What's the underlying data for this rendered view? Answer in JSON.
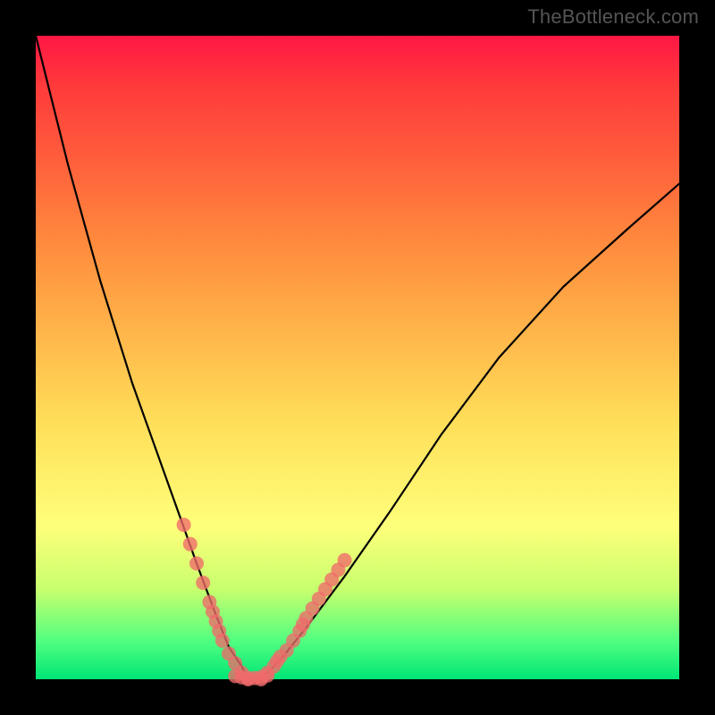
{
  "watermark": "TheBottleneck.com",
  "chart_data": {
    "type": "line",
    "title": "",
    "xlabel": "",
    "ylabel": "",
    "xlim": [
      0,
      100
    ],
    "ylim": [
      0,
      100
    ],
    "grid": false,
    "background_gradient": [
      "#ff1744",
      "#ff5a3c",
      "#ffde59",
      "#ffff7a",
      "#00e676"
    ],
    "series": [
      {
        "name": "left-branch",
        "color": "#000000",
        "x": [
          0,
          5,
          10,
          15,
          20,
          25,
          28,
          30,
          32,
          33
        ],
        "y": [
          100,
          80,
          62,
          46,
          32,
          18,
          10,
          5,
          2,
          0
        ]
      },
      {
        "name": "right-branch",
        "color": "#000000",
        "x": [
          35,
          38,
          42,
          48,
          55,
          63,
          72,
          82,
          92,
          100
        ],
        "y": [
          0,
          3,
          8,
          16,
          26,
          38,
          50,
          61,
          70,
          77
        ]
      }
    ],
    "marker_series": [
      {
        "name": "left-branch-markers",
        "color": "#f06a6a",
        "x": [
          23,
          24,
          25,
          26,
          27,
          27.5,
          28,
          28.5,
          29,
          30,
          31,
          32,
          33
        ],
        "y": [
          24,
          21,
          18,
          15,
          12,
          10.5,
          9,
          7.5,
          6,
          4,
          2.5,
          1,
          0
        ]
      },
      {
        "name": "right-branch-markers",
        "color": "#f06a6a",
        "x": [
          35,
          36,
          37,
          37.5,
          38,
          39,
          40,
          41,
          41.5,
          42,
          43,
          44,
          45,
          46,
          47,
          48
        ],
        "y": [
          0,
          1,
          2,
          2.8,
          3.5,
          4.5,
          6,
          7.5,
          8.5,
          9.5,
          11,
          12.5,
          14,
          15.5,
          17,
          18.5
        ]
      },
      {
        "name": "valley-markers",
        "color": "#f06a6a",
        "x": [
          31,
          32,
          33,
          34,
          35,
          36
        ],
        "y": [
          0.5,
          0.3,
          0.2,
          0.2,
          0.3,
          0.6
        ]
      }
    ]
  }
}
